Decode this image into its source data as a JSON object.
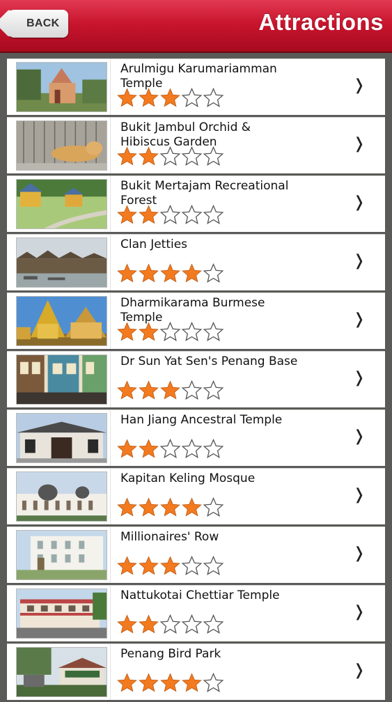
{
  "header": {
    "back_label": "BACK",
    "title": "Attractions"
  },
  "max_rating": 5,
  "colors": {
    "star_fill": "#f47a1f",
    "star_outline": "#555555",
    "accent": "#c9152e"
  },
  "items": [
    {
      "name": "Arulmigu Karumariamman\nTemple",
      "rating": 3
    },
    {
      "name": "Bukit Jambul Orchid &\nHibiscus Garden",
      "rating": 2
    },
    {
      "name": "Bukit Mertajam Recreational\nForest",
      "rating": 2
    },
    {
      "name": "Clan Jetties",
      "rating": 4
    },
    {
      "name": "Dharmikarama Burmese\nTemple",
      "rating": 2
    },
    {
      "name": "Dr Sun Yat Sen's Penang Base",
      "rating": 3
    },
    {
      "name": "Han Jiang Ancestral Temple",
      "rating": 2
    },
    {
      "name": "Kapitan Keling Mosque",
      "rating": 4
    },
    {
      "name": "Millionaires' Row",
      "rating": 3
    },
    {
      "name": "Nattukotai Chettiar Temple",
      "rating": 2
    },
    {
      "name": "Penang Bird Park",
      "rating": 4
    }
  ],
  "chevron_icon": "chevron-right-icon",
  "star_icon": "star-icon"
}
